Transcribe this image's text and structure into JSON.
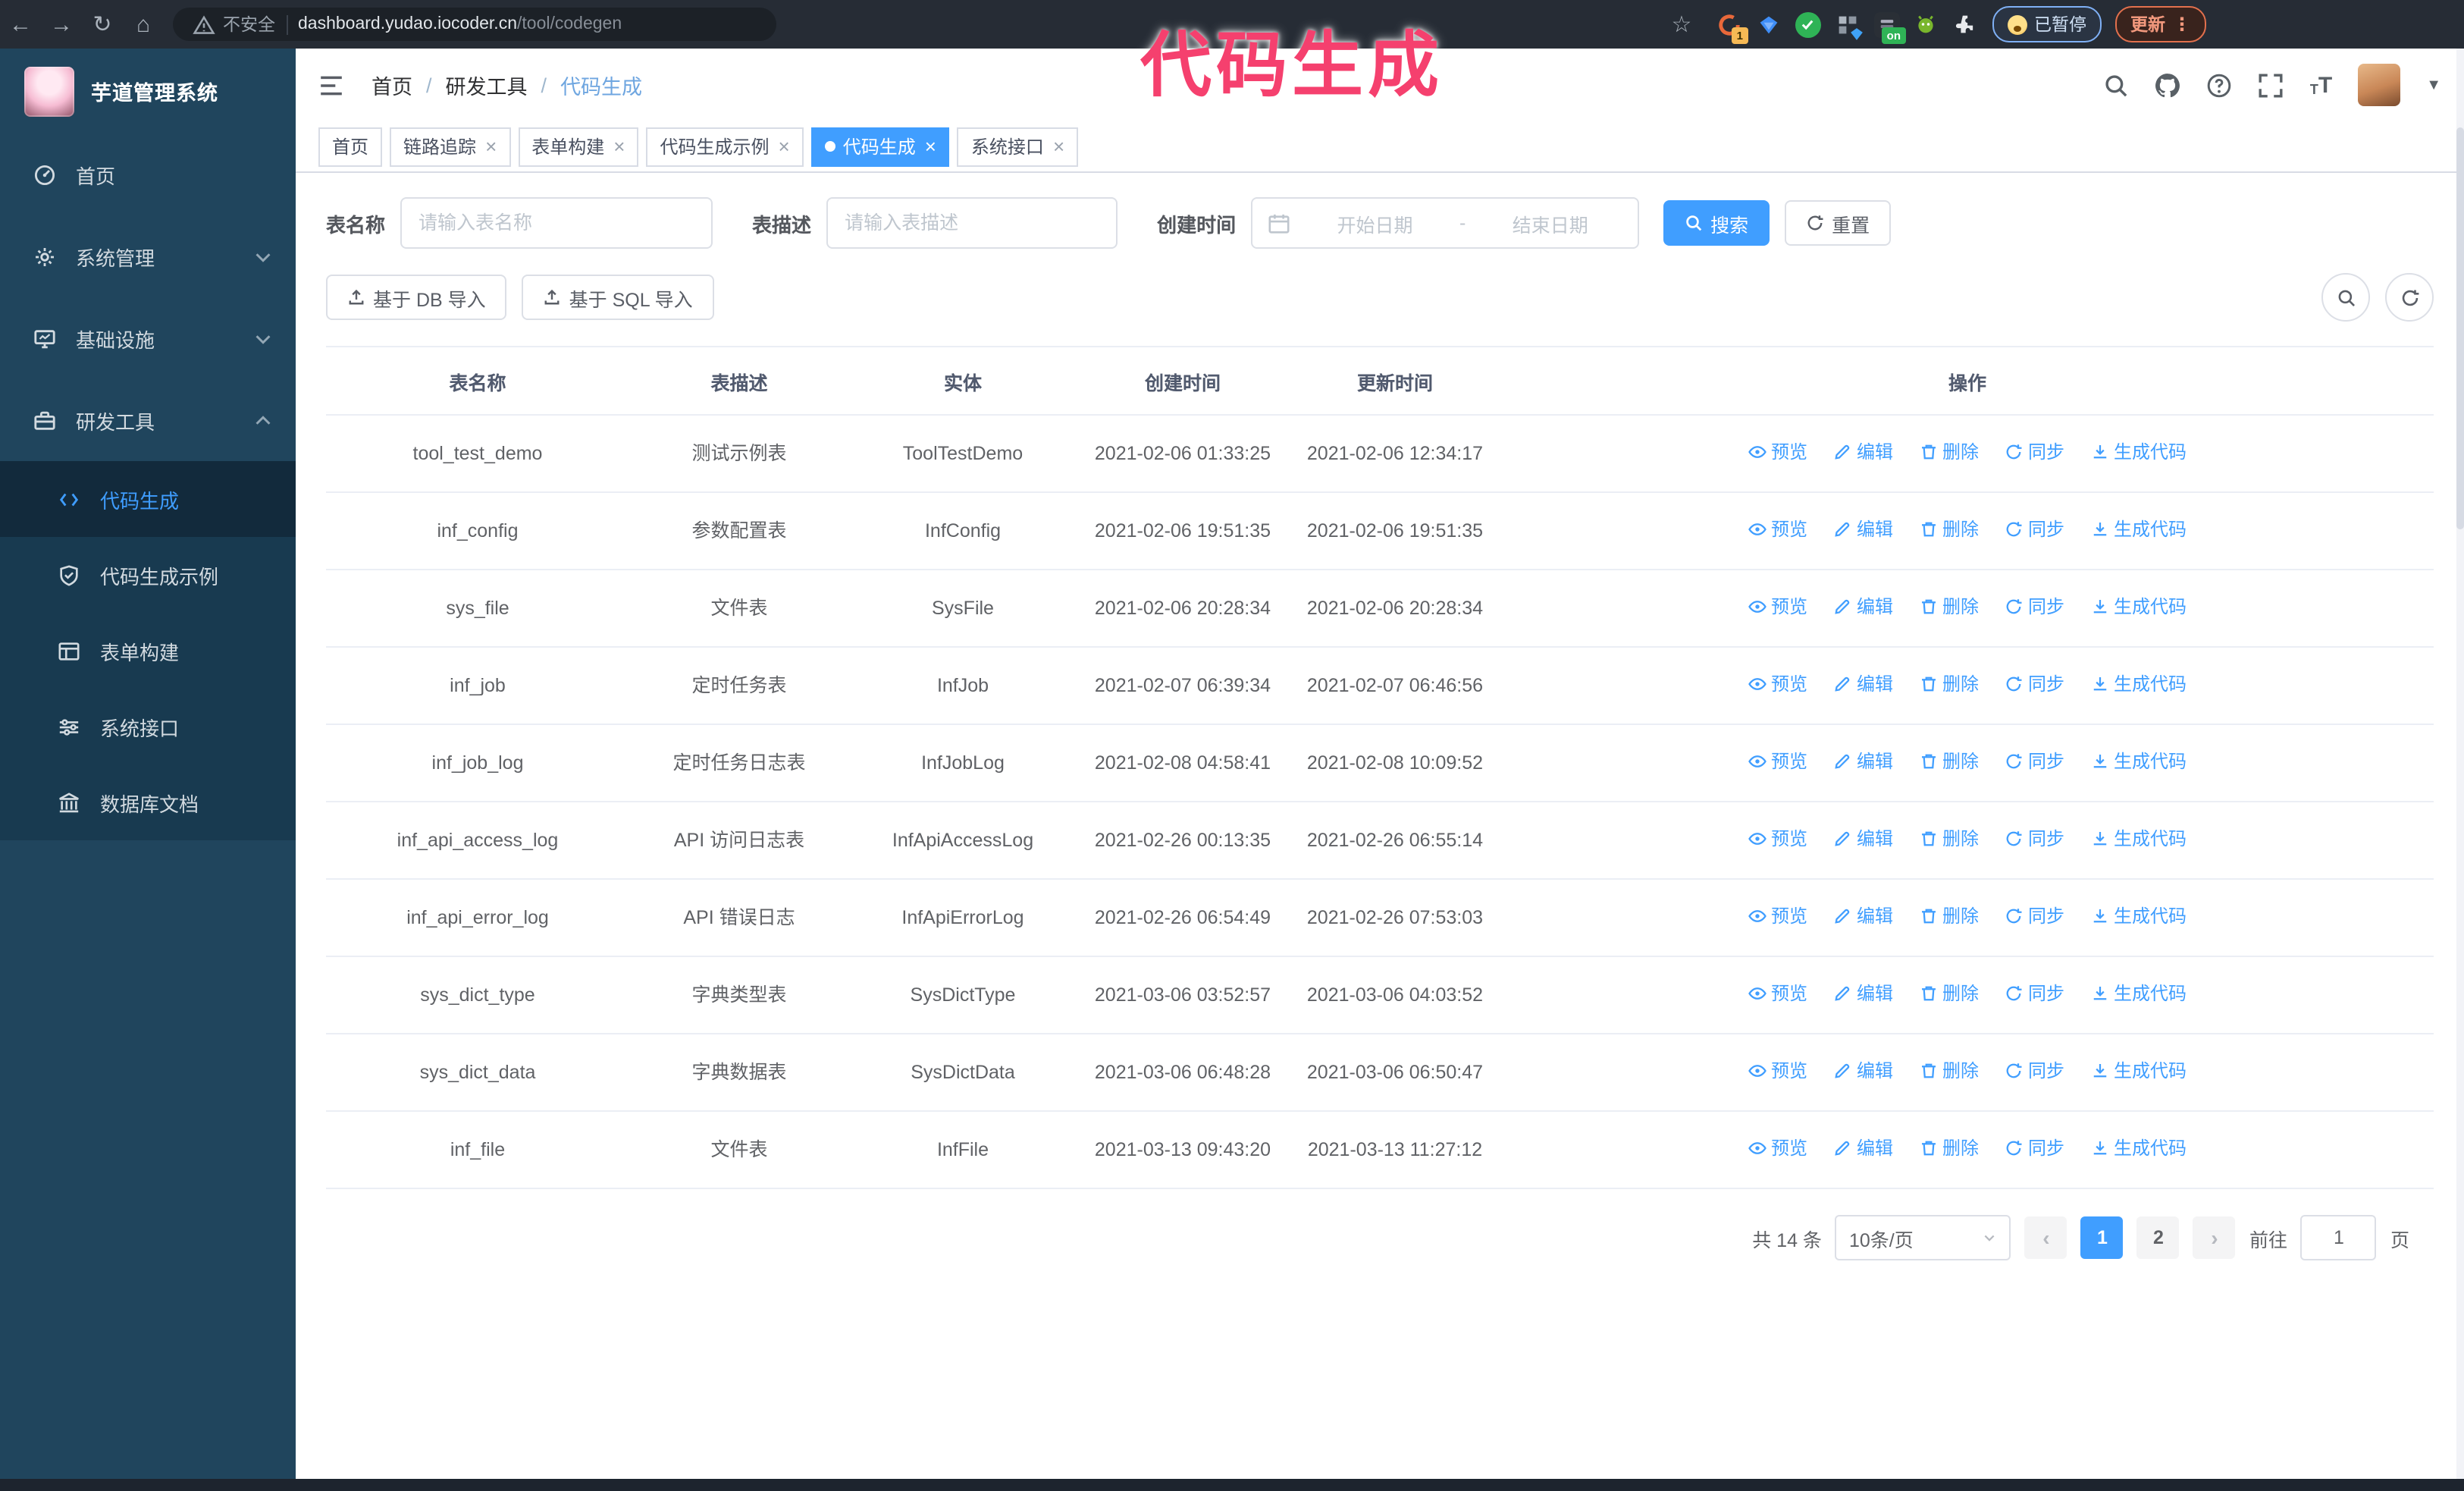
{
  "browser": {
    "security_label": "不安全",
    "url_host": "dashboard.yudao.iocoder.cn",
    "url_path": "/tool/codegen",
    "ext_badge_count": "1",
    "ext_badge_on": "on",
    "paused_badge": "已暂停",
    "update_button": "更新",
    "menu_dots": "⋮"
  },
  "annotation": {
    "label": "代码生成"
  },
  "sidebar": {
    "app_title": "芋道管理系统",
    "items": [
      {
        "label": "首页",
        "icon": "dashboard-icon"
      },
      {
        "label": "系统管理",
        "icon": "gear-icon",
        "state": "collapsed"
      },
      {
        "label": "基础设施",
        "icon": "monitor-icon",
        "state": "collapsed"
      },
      {
        "label": "研发工具",
        "icon": "toolbox-icon",
        "state": "expanded"
      }
    ],
    "submenu": [
      {
        "label": "代码生成",
        "icon": "code-icon",
        "active": true
      },
      {
        "label": "代码生成示例",
        "icon": "shield-check-icon",
        "active": false
      },
      {
        "label": "表单构建",
        "icon": "form-icon",
        "active": false
      },
      {
        "label": "系统接口",
        "icon": "sliders-icon",
        "active": false
      },
      {
        "label": "数据库文档",
        "icon": "bank-icon",
        "active": false
      }
    ]
  },
  "navbar": {
    "breadcrumb": [
      "首页",
      "研发工具",
      "代码生成"
    ],
    "breadcrumb_separator": "/"
  },
  "tabs": [
    {
      "label": "首页",
      "closable": false,
      "active": false
    },
    {
      "label": "链路追踪",
      "closable": true,
      "active": false
    },
    {
      "label": "表单构建",
      "closable": true,
      "active": false
    },
    {
      "label": "代码生成示例",
      "closable": true,
      "active": false
    },
    {
      "label": "代码生成",
      "closable": true,
      "active": true
    },
    {
      "label": "系统接口",
      "closable": true,
      "active": false
    }
  ],
  "filters": {
    "name_label": "表名称",
    "name_placeholder": "请输入表名称",
    "name_value": "",
    "desc_label": "表描述",
    "desc_placeholder": "请输入表描述",
    "desc_value": "",
    "time_label": "创建时间",
    "start_placeholder": "开始日期",
    "range_separator": "-",
    "end_placeholder": "结束日期",
    "search_button": "搜索",
    "reset_button": "重置"
  },
  "toolbar": {
    "import_db_button": "基于 DB 导入",
    "import_sql_button": "基于 SQL 导入"
  },
  "table": {
    "columns": [
      "表名称",
      "表描述",
      "实体",
      "创建时间",
      "更新时间",
      "操作"
    ],
    "actions": [
      "预览",
      "编辑",
      "删除",
      "同步",
      "生成代码"
    ],
    "rows": [
      {
        "name": "tool_test_demo",
        "desc": "测试示例表",
        "entity": "ToolTestDemo",
        "created": "2021-02-06 01:33:25",
        "updated": "2021-02-06 12:34:17"
      },
      {
        "name": "inf_config",
        "desc": "参数配置表",
        "entity": "InfConfig",
        "created": "2021-02-06 19:51:35",
        "updated": "2021-02-06 19:51:35"
      },
      {
        "name": "sys_file",
        "desc": "文件表",
        "entity": "SysFile",
        "created": "2021-02-06 20:28:34",
        "updated": "2021-02-06 20:28:34"
      },
      {
        "name": "inf_job",
        "desc": "定时任务表",
        "entity": "InfJob",
        "created": "2021-02-07 06:39:34",
        "updated": "2021-02-07 06:46:56"
      },
      {
        "name": "inf_job_log",
        "desc": "定时任务日志表",
        "entity": "InfJobLog",
        "created": "2021-02-08 04:58:41",
        "updated": "2021-02-08 10:09:52"
      },
      {
        "name": "inf_api_access_log",
        "desc": "API 访问日志表",
        "entity": "InfApiAccessLog",
        "created": "2021-02-26 00:13:35",
        "updated": "2021-02-26 06:55:14"
      },
      {
        "name": "inf_api_error_log",
        "desc": "API 错误日志",
        "entity": "InfApiErrorLog",
        "created": "2021-02-26 06:54:49",
        "updated": "2021-02-26 07:53:03"
      },
      {
        "name": "sys_dict_type",
        "desc": "字典类型表",
        "entity": "SysDictType",
        "created": "2021-03-06 03:52:57",
        "updated": "2021-03-06 04:03:52"
      },
      {
        "name": "sys_dict_data",
        "desc": "字典数据表",
        "entity": "SysDictData",
        "created": "2021-03-06 06:48:28",
        "updated": "2021-03-06 06:50:47"
      },
      {
        "name": "inf_file",
        "desc": "文件表",
        "entity": "InfFile",
        "created": "2021-03-13 09:43:20",
        "updated": "2021-03-13 11:27:12"
      }
    ]
  },
  "pagination": {
    "total_text": "共 14 条",
    "page_size": "10条/页",
    "pages": [
      "1",
      "2"
    ],
    "active_page": "1",
    "goto_label": "前往",
    "goto_value": "1",
    "page_unit": "页"
  },
  "colors": {
    "primary": "#409eff",
    "sidebar_bg": "#20455d",
    "submenu_bg": "#183a50",
    "annotation_pink": "#f5406e",
    "update_accent": "#e2704d",
    "paused_accent": "#7fb0f5",
    "browser_bar_bg": "#262c35"
  }
}
